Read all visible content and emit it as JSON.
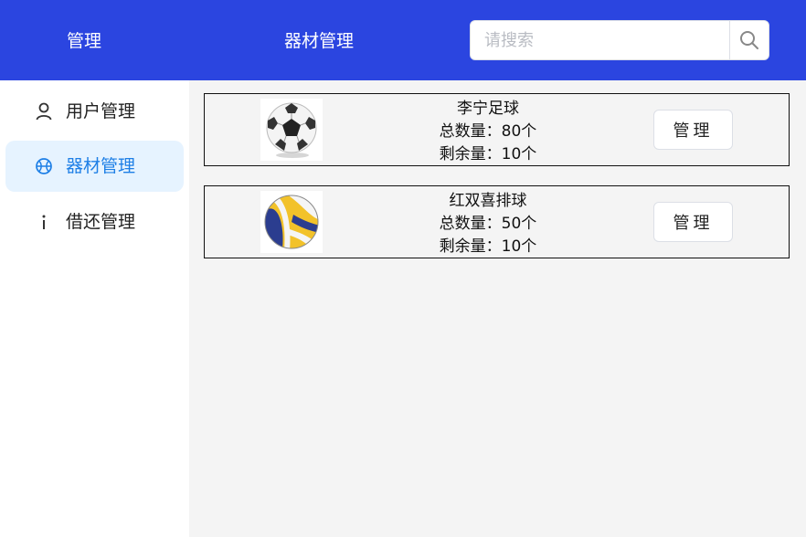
{
  "header": {
    "brand": "管理",
    "page_title": "器材管理",
    "search_placeholder": "请搜索",
    "search_icon": "search-icon",
    "background": "#2b45e0"
  },
  "sidebar": {
    "items": [
      {
        "label": "用户管理",
        "icon": "user-icon",
        "active": false
      },
      {
        "label": "器材管理",
        "icon": "basketball-icon",
        "active": true
      },
      {
        "label": "借还管理",
        "icon": "info-icon",
        "active": false
      }
    ],
    "active_color": "#1e7fe6",
    "active_background": "#e6f3ff"
  },
  "equipment": [
    {
      "name": "李宁足球",
      "total": "总数量：80个",
      "remaining": "剩余量：10个",
      "image": "soccer-ball-image",
      "button": "管理"
    },
    {
      "name": "红双喜排球",
      "total": "总数量：50个",
      "remaining": "剩余量：10个",
      "image": "volleyball-image",
      "button": "管理"
    }
  ]
}
